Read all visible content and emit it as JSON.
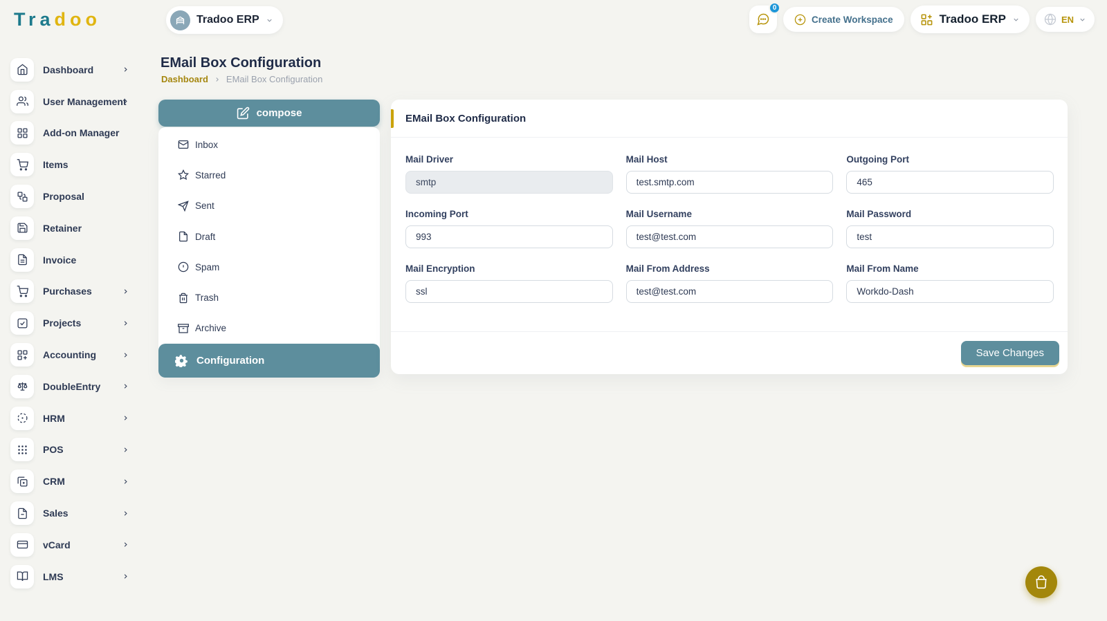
{
  "brand": {
    "logo_part1": "Tra",
    "logo_part2": "doo"
  },
  "topbar": {
    "workspace": {
      "label": "Tradoo ERP"
    },
    "chat_badge": "0",
    "create_workspace_label": "Create Workspace",
    "app_menu_label": "Tradoo ERP",
    "language": "EN"
  },
  "sidebar": {
    "items": [
      {
        "label": "Dashboard",
        "icon": "home",
        "expandable": true
      },
      {
        "label": "User Management",
        "icon": "users",
        "expandable": true
      },
      {
        "label": "Add-on Manager",
        "icon": "grid",
        "expandable": false
      },
      {
        "label": "Items",
        "icon": "shopping-cart",
        "expandable": false
      },
      {
        "label": "Proposal",
        "icon": "workflow",
        "expandable": false
      },
      {
        "label": "Retainer",
        "icon": "save",
        "expandable": false
      },
      {
        "label": "Invoice",
        "icon": "file-invoice",
        "expandable": false
      },
      {
        "label": "Purchases",
        "icon": "shopping-cart",
        "expandable": true
      },
      {
        "label": "Projects",
        "icon": "check-square",
        "expandable": true
      },
      {
        "label": "Accounting",
        "icon": "grid-plus",
        "expandable": true
      },
      {
        "label": "DoubleEntry",
        "icon": "scale",
        "expandable": true
      },
      {
        "label": "HRM",
        "icon": "target",
        "expandable": true
      },
      {
        "label": "POS",
        "icon": "dots-grid",
        "expandable": true
      },
      {
        "label": "CRM",
        "icon": "window-plus",
        "expandable": true
      },
      {
        "label": "Sales",
        "icon": "file",
        "expandable": true
      },
      {
        "label": "vCard",
        "icon": "credit-card",
        "expandable": true
      },
      {
        "label": "LMS",
        "icon": "book-open",
        "expandable": true
      }
    ]
  },
  "page": {
    "title": "EMail Box Configuration",
    "breadcrumb": {
      "parent": "Dashboard",
      "current": "EMail Box Configuration"
    }
  },
  "mail_nav": {
    "compose_label": "compose",
    "folders": [
      {
        "label": "Inbox",
        "icon": "mail"
      },
      {
        "label": "Starred",
        "icon": "star"
      },
      {
        "label": "Sent",
        "icon": "send"
      },
      {
        "label": "Draft",
        "icon": "file"
      },
      {
        "label": "Spam",
        "icon": "alert-circle"
      },
      {
        "label": "Trash",
        "icon": "trash"
      },
      {
        "label": "Archive",
        "icon": "archive"
      }
    ],
    "configuration_label": "Configuration"
  },
  "form": {
    "title": "EMail Box Configuration",
    "fields": [
      {
        "label": "Mail Driver",
        "value": "smtp",
        "disabled": true
      },
      {
        "label": "Mail Host",
        "value": "test.smtp.com",
        "disabled": false
      },
      {
        "label": "Outgoing Port",
        "value": "465",
        "disabled": false
      },
      {
        "label": "Incoming Port",
        "value": "993",
        "disabled": false
      },
      {
        "label": "Mail Username",
        "value": "test@test.com",
        "disabled": false
      },
      {
        "label": "Mail Password",
        "value": "test",
        "disabled": false
      },
      {
        "label": "Mail Encryption",
        "value": "ssl",
        "disabled": false
      },
      {
        "label": "Mail From Address",
        "value": "test@test.com",
        "disabled": false
      },
      {
        "label": "Mail From Name",
        "value": "Workdo-Dash",
        "disabled": false
      }
    ],
    "save_label": "Save Changes"
  },
  "colors": {
    "teal": "#5d8e9d",
    "gold": "#b7940b",
    "logo_teal": "#1d7a8c",
    "logo_yellow": "#e0b511",
    "navy": "#2e3a54",
    "badge_blue": "#1e96d8",
    "background": "#f4f4f0",
    "fab_gold": "#a3870b"
  }
}
